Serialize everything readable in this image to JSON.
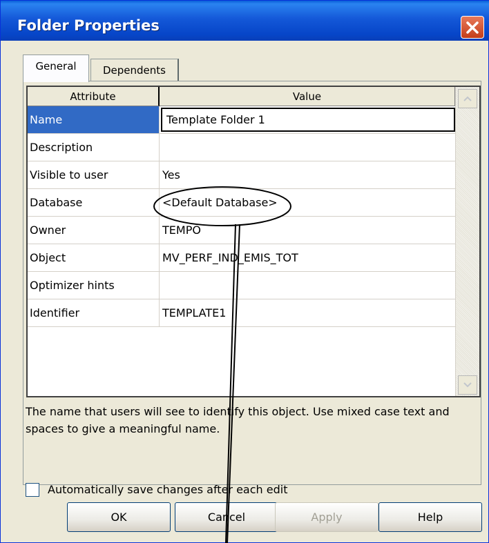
{
  "window": {
    "title": "Folder Properties"
  },
  "tabs": [
    {
      "label": "General"
    },
    {
      "label": "Dependents"
    }
  ],
  "grid": {
    "headers": {
      "attribute": "Attribute",
      "value": "Value"
    },
    "rows": [
      {
        "attribute": "Name",
        "value": "Template Folder 1"
      },
      {
        "attribute": "Description",
        "value": ""
      },
      {
        "attribute": "Visible to user",
        "value": "Yes"
      },
      {
        "attribute": "Database",
        "value": "<Default Database>"
      },
      {
        "attribute": "Owner",
        "value": "TEMPO"
      },
      {
        "attribute": "Object",
        "value": "MV_PERF_IND_EMIS_TOT"
      },
      {
        "attribute": "Optimizer hints",
        "value": ""
      },
      {
        "attribute": "Identifier",
        "value": "TEMPLATE1"
      }
    ]
  },
  "description": "The name that users will see to identify this object. Use mixed case text and spaces to give a meaningful name.",
  "autosave": {
    "label": "Automatically save changes after each edit",
    "checked": false
  },
  "buttons": {
    "ok": "OK",
    "cancel": "Cancel",
    "apply": "Apply",
    "help": "Help"
  },
  "colors": {
    "selection": "#316ac5",
    "titlebar": "#0645c8",
    "close": "#c43e1a"
  }
}
